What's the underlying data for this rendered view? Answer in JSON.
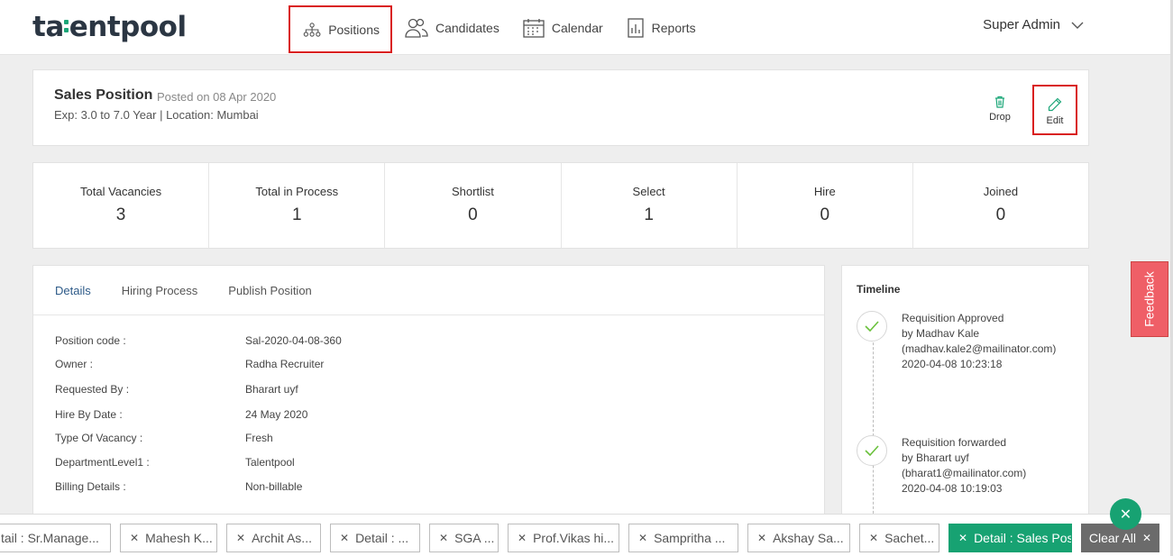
{
  "brand": {
    "logo_pre": "ta",
    "logo_post": "entpool",
    "accent": "#1ba678"
  },
  "nav": {
    "items": [
      {
        "label": "Positions",
        "icon": "org-chart-icon"
      },
      {
        "label": "Candidates",
        "icon": "people-icon"
      },
      {
        "label": "Calendar",
        "icon": "calendar-icon"
      },
      {
        "label": "Reports",
        "icon": "report-icon"
      }
    ],
    "user": "Super Admin"
  },
  "position": {
    "title": "Sales Position",
    "posted": "Posted on 08 Apr 2020",
    "meta": "Exp: 3.0 to 7.0 Year | Location: Mumbai",
    "drop_label": "Drop",
    "edit_label": "Edit"
  },
  "stats": [
    {
      "label": "Total Vacancies",
      "value": "3"
    },
    {
      "label": "Total in Process",
      "value": "1"
    },
    {
      "label": "Shortlist",
      "value": "0"
    },
    {
      "label": "Select",
      "value": "1"
    },
    {
      "label": "Hire",
      "value": "0"
    },
    {
      "label": "Joined",
      "value": "0"
    }
  ],
  "tabs": [
    "Details",
    "Hiring Process",
    "Publish Position"
  ],
  "details": [
    {
      "key": "Position code :",
      "value": "Sal-2020-04-08-360"
    },
    {
      "key": "Owner :",
      "value": "Radha Recruiter"
    },
    {
      "key": "Requested By :",
      "value": "Bharart uyf"
    },
    {
      "key": "Hire By Date :",
      "value": "24 May 2020"
    },
    {
      "key": "Type Of Vacancy :",
      "value": "Fresh"
    },
    {
      "key": "DepartmentLevel1 :",
      "value": "Talentpool"
    },
    {
      "key": "Billing Details :",
      "value": "Non-billable"
    }
  ],
  "timeline": {
    "title": "Timeline",
    "items": [
      {
        "line1": "Requisition Approved",
        "line2": "by Madhav Kale",
        "line3": "(madhav.kale2@mailinator.com)",
        "line4": "2020-04-08 10:23:18"
      },
      {
        "line1": "Requisition forwarded",
        "line2": "by Bharart uyf",
        "line3": "(bharat1@mailinator.com)",
        "line4": "2020-04-08 10:19:03"
      }
    ]
  },
  "feedback_label": "Feedback",
  "bottom_tabs": [
    {
      "label": "tail : Sr.Manage..."
    },
    {
      "label": "Mahesh K..."
    },
    {
      "label": "Archit As..."
    },
    {
      "label": "Detail : ..."
    },
    {
      "label": "SGA ..."
    },
    {
      "label": "Prof.Vikas hi..."
    },
    {
      "label": "Sampritha ..."
    },
    {
      "label": "Akshay Sa..."
    },
    {
      "label": "Sachet..."
    },
    {
      "label": "Detail : Sales Posi"
    }
  ],
  "clear_all_label": "Clear All"
}
